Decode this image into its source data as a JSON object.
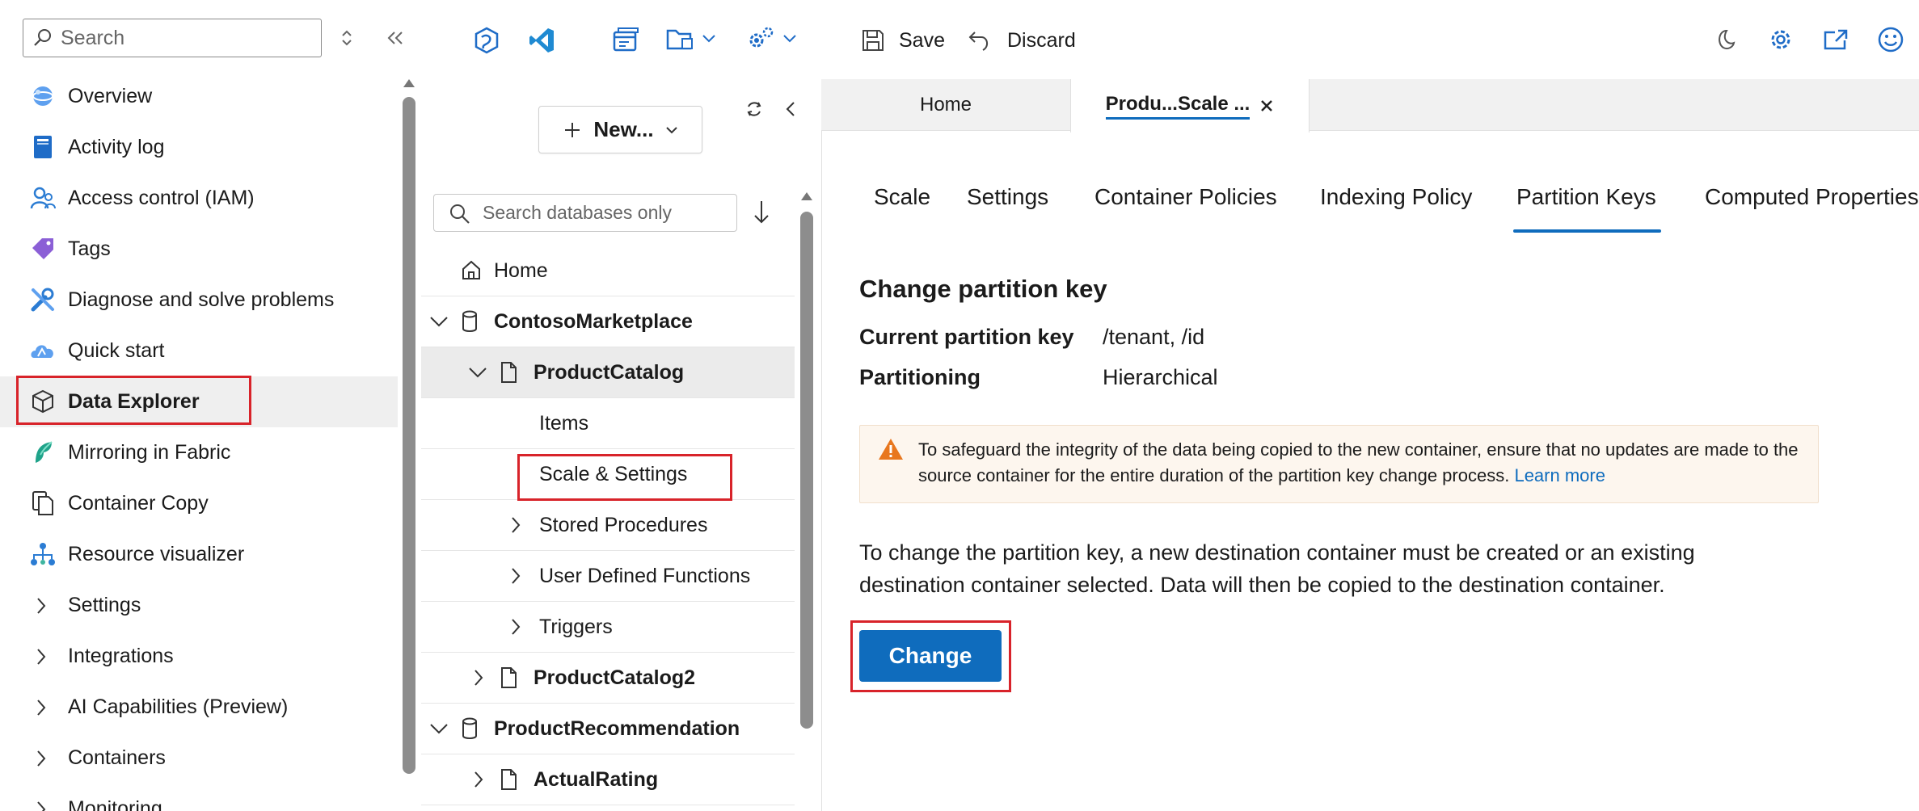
{
  "header": {
    "search_placeholder": "Search",
    "toolbar": {
      "save_label": "Save",
      "discard_label": "Discard"
    }
  },
  "sidebar": {
    "items": [
      {
        "label": "Overview",
        "icon": "globe-icon"
      },
      {
        "label": "Activity log",
        "icon": "activity-log-icon"
      },
      {
        "label": "Access control (IAM)",
        "icon": "people-icon"
      },
      {
        "label": "Tags",
        "icon": "tag-icon"
      },
      {
        "label": "Diagnose and solve problems",
        "icon": "wrench-icon"
      },
      {
        "label": "Quick start",
        "icon": "cloud-icon"
      },
      {
        "label": "Data Explorer",
        "icon": "cube-icon"
      },
      {
        "label": "Mirroring in Fabric",
        "icon": "fabric-icon"
      },
      {
        "label": "Container Copy",
        "icon": "copy-icon"
      },
      {
        "label": "Resource visualizer",
        "icon": "hierarchy-icon"
      },
      {
        "label": "Settings",
        "icon": "chevron-right-icon"
      },
      {
        "label": "Integrations",
        "icon": "chevron-right-icon"
      },
      {
        "label": "AI Capabilities (Preview)",
        "icon": "chevron-right-icon"
      },
      {
        "label": "Containers",
        "icon": "chevron-right-icon"
      },
      {
        "label": "Monitoring",
        "icon": "chevron-right-icon"
      }
    ]
  },
  "tree": {
    "new_label": "New...",
    "search_placeholder": "Search databases only",
    "rows": [
      {
        "label": "Home"
      },
      {
        "label": "ContosoMarketplace"
      },
      {
        "label": "ProductCatalog"
      },
      {
        "label": "Items"
      },
      {
        "label": "Scale & Settings"
      },
      {
        "label": "Stored Procedures"
      },
      {
        "label": "User Defined Functions"
      },
      {
        "label": "Triggers"
      },
      {
        "label": "ProductCatalog2"
      },
      {
        "label": "ProductRecommendation"
      },
      {
        "label": "ActualRating"
      }
    ]
  },
  "tabs": {
    "home_label": "Home",
    "active_label": "Produ...Scale ..."
  },
  "pivots": [
    "Scale",
    "Settings",
    "Container Policies",
    "Indexing Policy",
    "Partition Keys",
    "Computed Properties"
  ],
  "panel": {
    "heading": "Change partition key",
    "current_key_label": "Current partition key",
    "current_key_value": "/tenant, /id",
    "partitioning_label": "Partitioning",
    "partitioning_value": "Hierarchical",
    "warning_text": "To safeguard the integrity of the data being copied to the new container, ensure that no updates are made to the source container for the entire duration of the partition key change process.",
    "learn_more": "Learn more",
    "description": "To change the partition key, a new destination container must be created or an existing destination container selected. Data will then be copied to the destination container.",
    "change_button": "Change"
  },
  "colors": {
    "accent": "#0f6cbd",
    "highlight_box": "#d8232a",
    "warning_bg": "#fdf6ee",
    "warning_icon": "#e8771e"
  }
}
